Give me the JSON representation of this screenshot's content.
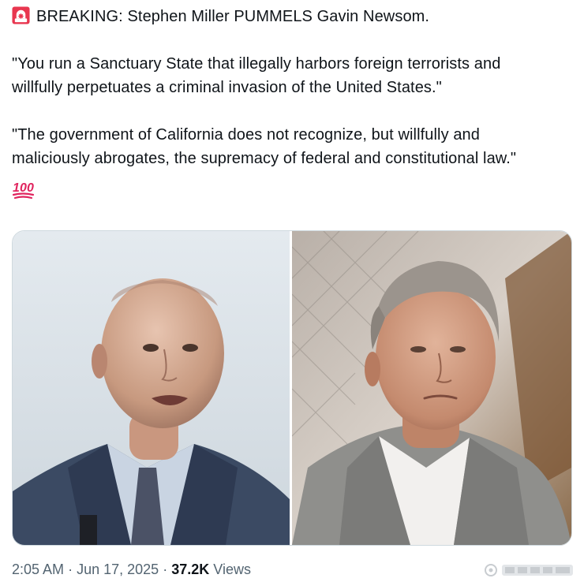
{
  "tweet": {
    "lines": [
      "BREAKING: Stephen Miller PUMMELS Gavin Newsom.",
      "\"You run a Sanctuary State that illegally harbors foreign terrorists and",
      "willfully perpetuates a criminal invasion of the United States.\"",
      "\"The government of California does not recognize, but willfully and",
      "maliciously abrogates, the supremacy of federal and constitutional law.\""
    ],
    "leading_icon": "police-siren-emoji",
    "trailing_icon": "hundred-points-emoji",
    "emoji_100_text": "100"
  },
  "media": {
    "left_photo": "portrait of bald man in navy suit and patterned tie, pale sky background",
    "right_photo": "portrait of gray-haired man in gray jacket and white shirt, blurred fence background"
  },
  "meta": {
    "time": "2:05 AM",
    "separator": "·",
    "date": "Jun 17, 2025",
    "views_count": "37.2K",
    "views_label": "Views"
  },
  "colors": {
    "text": "#0f1419",
    "secondary": "#536471",
    "border": "#cfd9de",
    "emoji_red": "#e0245e"
  }
}
